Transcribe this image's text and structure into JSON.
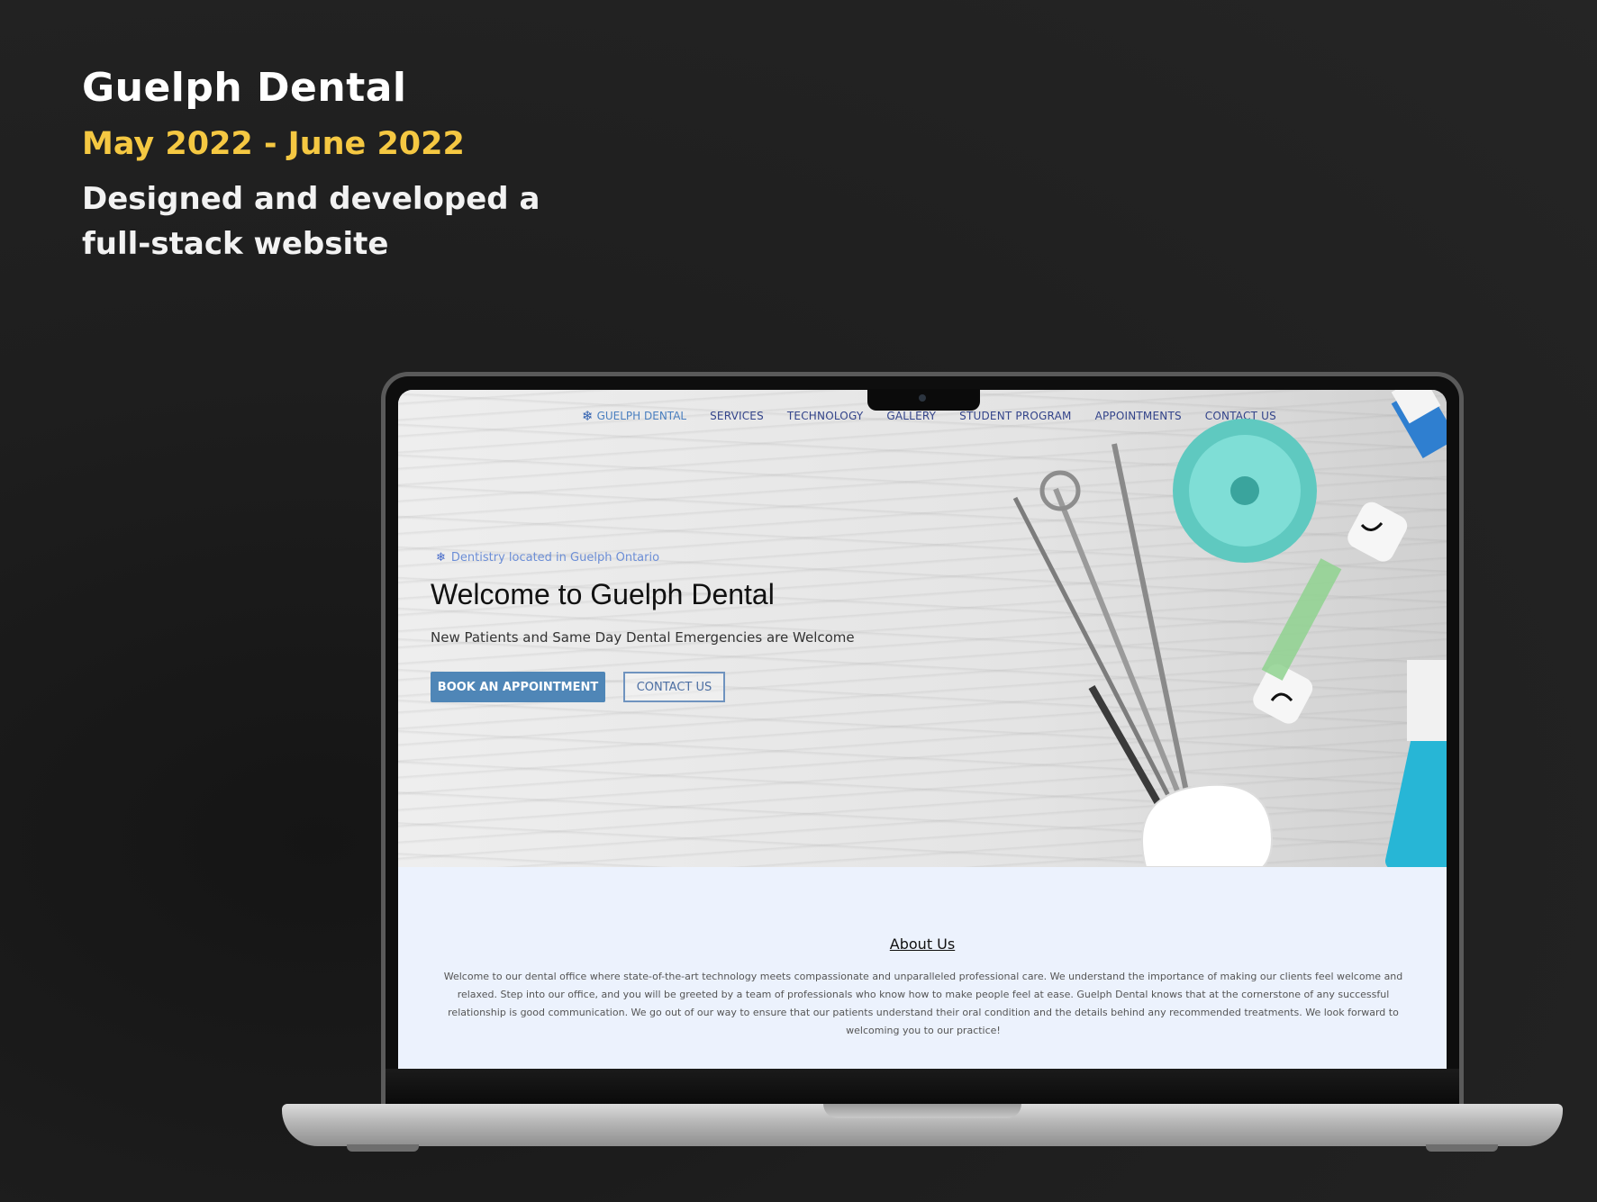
{
  "intro": {
    "title": "Guelph Dental",
    "dates": "May 2022 - June 2022",
    "description": "Designed and developed a full-stack website"
  },
  "site": {
    "nav": {
      "brand": "GUELPH DENTAL",
      "items": [
        "SERVICES",
        "TECHNOLOGY",
        "GALLERY",
        "STUDENT PROGRAM",
        "APPOINTMENTS",
        "CONTACT US"
      ]
    },
    "hero": {
      "tagline": "Dentistry located in Guelph Ontario",
      "title": "Welcome to Guelph Dental",
      "subtitle": "New Patients and Same Day Dental Emergencies are Welcome",
      "book_button": "BOOK AN APPOINTMENT",
      "contact_button": "CONTACT US"
    },
    "about": {
      "title": "About Us",
      "text": "Welcome to our dental office where state-of-the-art technology meets compassionate and unparalleled professional care. We understand the importance of making our clients feel welcome and relaxed. Step into our office, and you will be greeted by a team of professionals who know how to make people feel at ease. Guelph Dental knows that at the cornerstone of any successful relationship is good communication. We go out of our way to ensure that our patients understand their oral condition and the details behind any recommended treatments. We look forward to welcoming you to our practice!"
    }
  },
  "colors": {
    "accent": "#f5c842",
    "brand_blue": "#4f86b7"
  }
}
